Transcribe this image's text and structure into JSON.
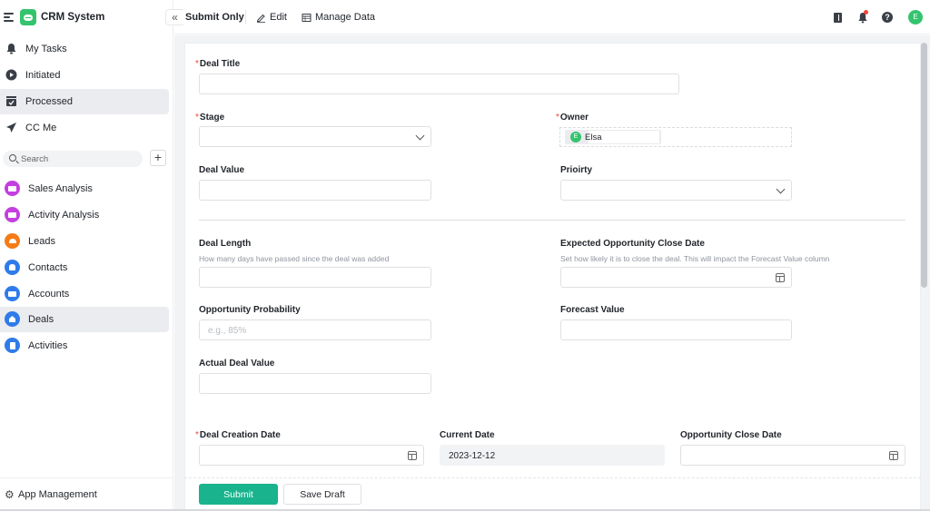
{
  "app": {
    "name": "CRM System"
  },
  "sidebar": {
    "collapse_icon": "double-chevron-left-icon",
    "nav": [
      {
        "label": "My Tasks",
        "icon": "bell-icon"
      },
      {
        "label": "Initiated",
        "icon": "play-circle-icon"
      },
      {
        "label": "Processed",
        "icon": "inbox-check-icon",
        "active": true
      },
      {
        "label": "CC Me",
        "icon": "send-icon"
      }
    ],
    "search": {
      "placeholder": "Search"
    },
    "apps": [
      {
        "label": "Sales Analysis",
        "icon": "chart-monitor-icon",
        "color": "#c43fe0"
      },
      {
        "label": "Activity Analysis",
        "icon": "chart-monitor-icon",
        "color": "#c43fe0"
      },
      {
        "label": "Leads",
        "icon": "alarm-icon",
        "color": "#f47b16"
      },
      {
        "label": "Contacts",
        "icon": "person-icon",
        "color": "#2f7bea"
      },
      {
        "label": "Accounts",
        "icon": "briefcase-icon",
        "color": "#2f7bea"
      },
      {
        "label": "Deals",
        "icon": "house-icon",
        "color": "#2f7bea",
        "active": true
      },
      {
        "label": "Activities",
        "icon": "document-icon",
        "color": "#2f7bea"
      }
    ],
    "footer": {
      "label": "App Management"
    }
  },
  "topbar": {
    "title": "Submit Only",
    "edit_label": "Edit",
    "manage_label": "Manage Data",
    "avatar_initial": "E"
  },
  "form": {
    "deal_title": {
      "label": "Deal Title",
      "required": true,
      "value": ""
    },
    "stage": {
      "label": "Stage",
      "required": true,
      "value": ""
    },
    "owner": {
      "label": "Owner",
      "required": true,
      "value": "Elsa",
      "initial": "E"
    },
    "deal_value": {
      "label": "Deal Value",
      "value": ""
    },
    "priority": {
      "label": "Prioirty",
      "value": ""
    },
    "deal_length": {
      "label": "Deal Length",
      "hint": "How many days have passed since the deal was added",
      "value": ""
    },
    "expected_close": {
      "label": "Expected Opportunity Close Date",
      "hint": "Set how likely it is to close the deal. This will impact the Forecast Value column",
      "value": ""
    },
    "probability": {
      "label": "Opportunity Probability",
      "placeholder": "e.g., 85%",
      "value": ""
    },
    "forecast_value": {
      "label": "Forecast Value",
      "value": ""
    },
    "actual_value": {
      "label": "Actual Deal Value",
      "value": ""
    },
    "creation_date": {
      "label": "Deal Creation Date",
      "required": true,
      "value": ""
    },
    "current_date": {
      "label": "Current Date",
      "value": "2023-12-12"
    },
    "close_date": {
      "label": "Opportunity Close Date",
      "value": ""
    },
    "required_marker": "*"
  },
  "actions": {
    "submit_label": "Submit",
    "draft_label": "Save Draft"
  },
  "colors": {
    "primary": "#19b38d",
    "brand": "#34c46e",
    "required": "#f04438"
  }
}
